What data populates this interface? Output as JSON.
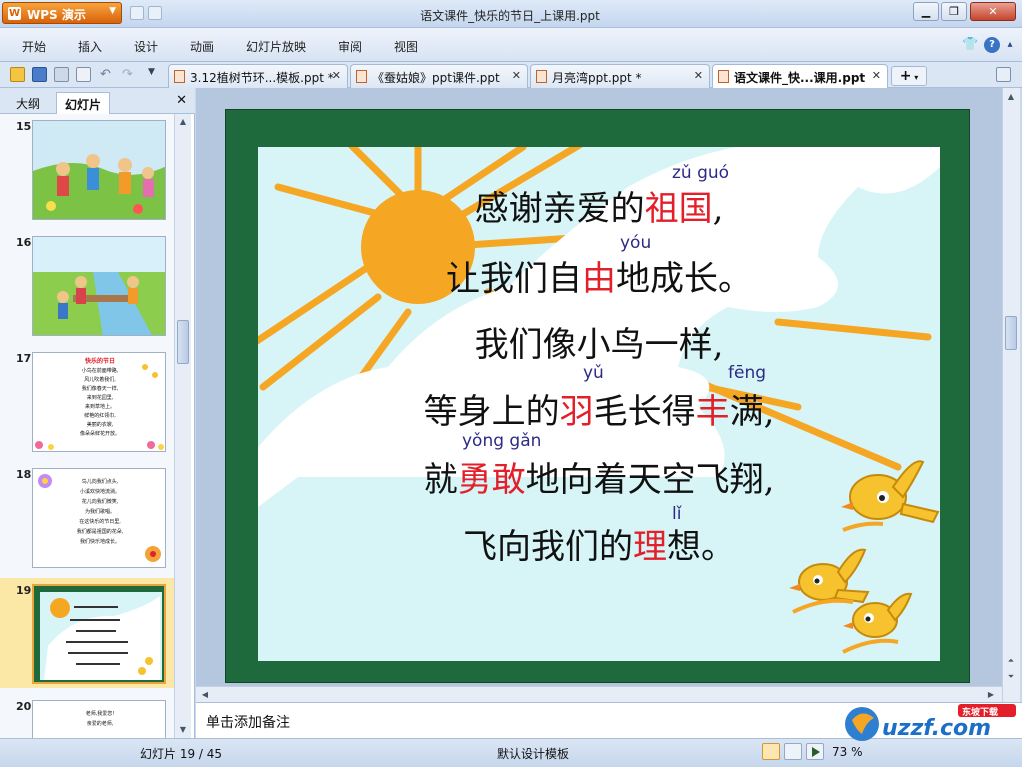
{
  "app": {
    "name": "WPS 演示",
    "window_title": "语文课件_快乐的节日_上课用.ppt"
  },
  "menu": [
    "开始",
    "插入",
    "设计",
    "动画",
    "幻灯片放映",
    "审阅",
    "视图"
  ],
  "doc_tabs": [
    {
      "label": "3.12植树节环...模板.ppt *",
      "active": false
    },
    {
      "label": "《蚕姑娘》ppt课件.ppt",
      "active": false
    },
    {
      "label": "月亮湾ppt.ppt *",
      "active": false
    },
    {
      "label": "语文课件_快...课用.ppt",
      "active": true
    }
  ],
  "panel": {
    "tabs": [
      "大纲",
      "幻灯片"
    ],
    "active_tab": "幻灯片"
  },
  "thumbnails": [
    {
      "num": "15",
      "kind": "picture-kids"
    },
    {
      "num": "16",
      "kind": "picture-bridge"
    },
    {
      "num": "17",
      "kind": "text",
      "title": "快乐的节日",
      "lines": [
        "小鸟在前面带路,",
        "风儿吹着我们,",
        "我们像春天一样,",
        "来到花园里,",
        "来到草地上。",
        "鲜艳的红领巾,",
        "美丽的衣裳,",
        "像朵朵鲜花开放。"
      ]
    },
    {
      "num": "18",
      "kind": "text",
      "lines": [
        "鸟儿向我们点头,",
        "小溪欢快地流淌。",
        "花儿向我们微笑,",
        "为我们歌唱。",
        "在这快乐的节日里,",
        "我们都是祖国的花朵,",
        "我们快乐地成长。"
      ]
    },
    {
      "num": "19",
      "kind": "current",
      "selected": true
    },
    {
      "num": "20",
      "kind": "text",
      "lines": [
        "老师,我爱您!",
        "亲爱的老师,"
      ]
    }
  ],
  "slide": {
    "lines": [
      {
        "segments": [
          {
            "t": "感谢亲爱的",
            "red": false
          },
          {
            "t": "祖国",
            "red": true
          },
          {
            "t": ",",
            "red": false
          }
        ]
      },
      {
        "segments": [
          {
            "t": "让我们自",
            "red": false
          },
          {
            "t": "由",
            "red": true
          },
          {
            "t": "地成长。",
            "red": false
          }
        ]
      },
      {
        "segments": [
          {
            "t": "我们像小鸟一样,",
            "red": false
          }
        ]
      },
      {
        "segments": [
          {
            "t": "等身上的",
            "red": false
          },
          {
            "t": "羽",
            "red": true
          },
          {
            "t": "毛长得",
            "red": false
          },
          {
            "t": "丰",
            "red": true
          },
          {
            "t": "满,",
            "red": false
          }
        ]
      },
      {
        "segments": [
          {
            "t": "就",
            "red": false
          },
          {
            "t": "勇敢",
            "red": true
          },
          {
            "t": "地向着天空飞翔,",
            "red": false
          }
        ]
      },
      {
        "segments": [
          {
            "t": "飞向我们的",
            "red": false
          },
          {
            "t": "理",
            "red": true
          },
          {
            "t": "想。",
            "red": false
          }
        ]
      }
    ],
    "pinyin": {
      "zuguo": "zǔ guó",
      "you": "yóu",
      "yu": "yǔ",
      "feng": "fēng",
      "yonggan": "yǒng gǎn",
      "li": "lǐ"
    }
  },
  "notes_placeholder": "单击添加备注",
  "status": {
    "slide_count": "幻灯片 19 / 45",
    "template": "默认设计模板",
    "zoom": "73 %"
  },
  "watermark": {
    "text": "uzzf.com",
    "tagline": "东坡下载"
  }
}
